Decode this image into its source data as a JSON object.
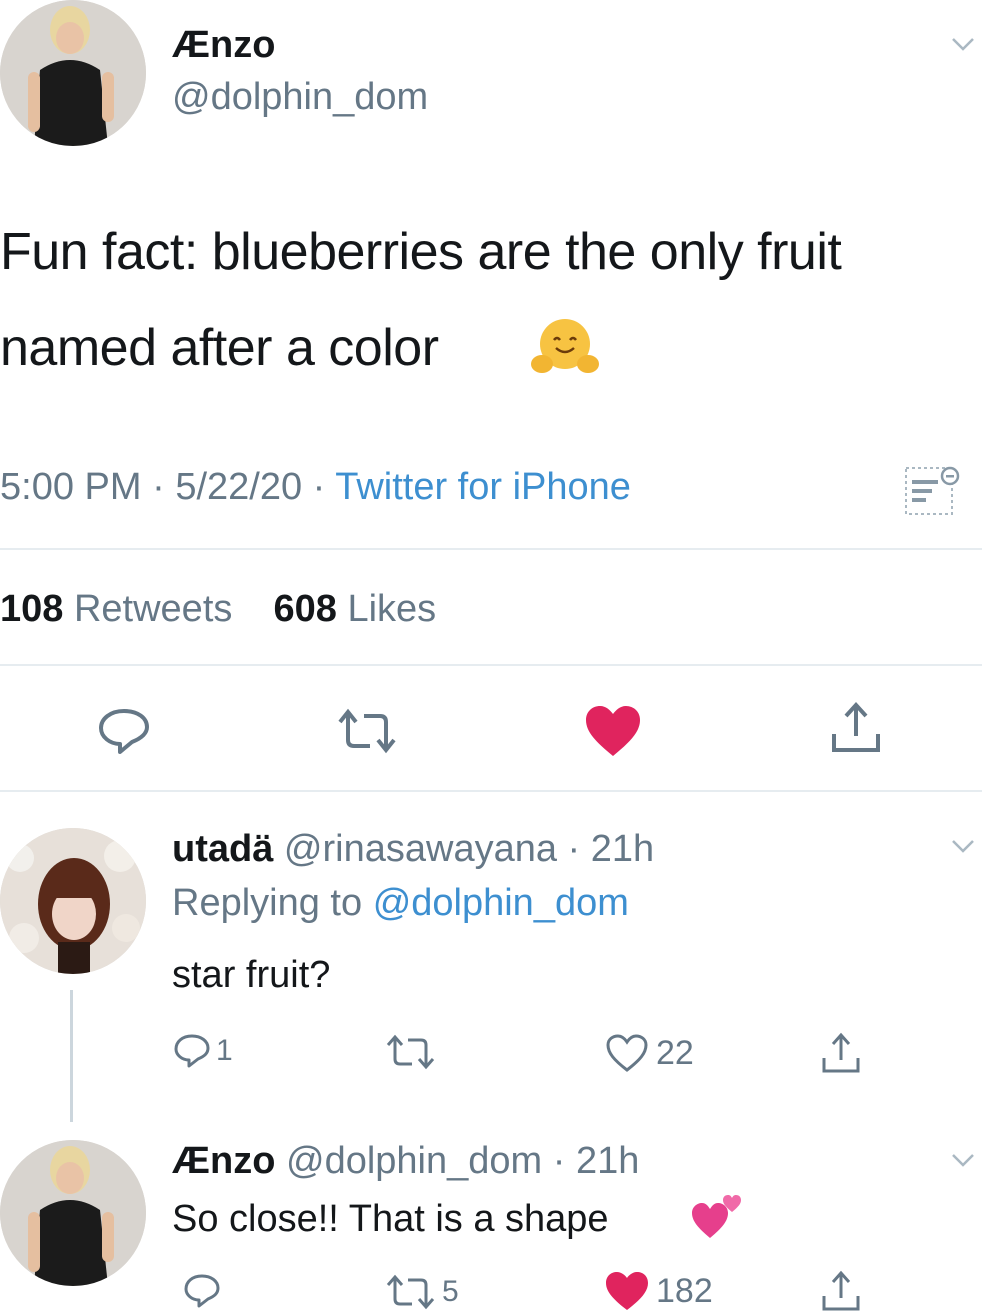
{
  "main_tweet": {
    "display_name": "Ænzo",
    "handle": "@dolphin_dom",
    "text_line1": "Fun fact: blueberries are the only fruit",
    "text_line2": "named after a color",
    "emoji": "hugging-face",
    "time": "5:00 PM",
    "sep1": "·",
    "date": "5/22/20",
    "sep2": "·",
    "source": "Twitter for iPhone",
    "retweets_count": "108",
    "retweets_label": "Retweets",
    "likes_count": "608",
    "likes_label": "Likes"
  },
  "reply1": {
    "display_name": "utadä",
    "handle": "@rinasawayana",
    "sep": "·",
    "time": "21h",
    "replying_prefix": "Replying to",
    "replying_handle": "@dolphin_dom",
    "text": "star fruit?",
    "reply_count": "1",
    "retweet_count": "",
    "like_count": "22"
  },
  "reply2": {
    "display_name": "Ænzo",
    "handle": "@dolphin_dom",
    "sep": "·",
    "time": "21h",
    "text": "So close!! That is a shape",
    "emoji": "two-hearts",
    "reply_count": "",
    "retweet_count": "5",
    "like_count": "182"
  },
  "colors": {
    "like_red": "#e0245e",
    "link_blue": "#3d8fd0",
    "gray": "#657786"
  }
}
